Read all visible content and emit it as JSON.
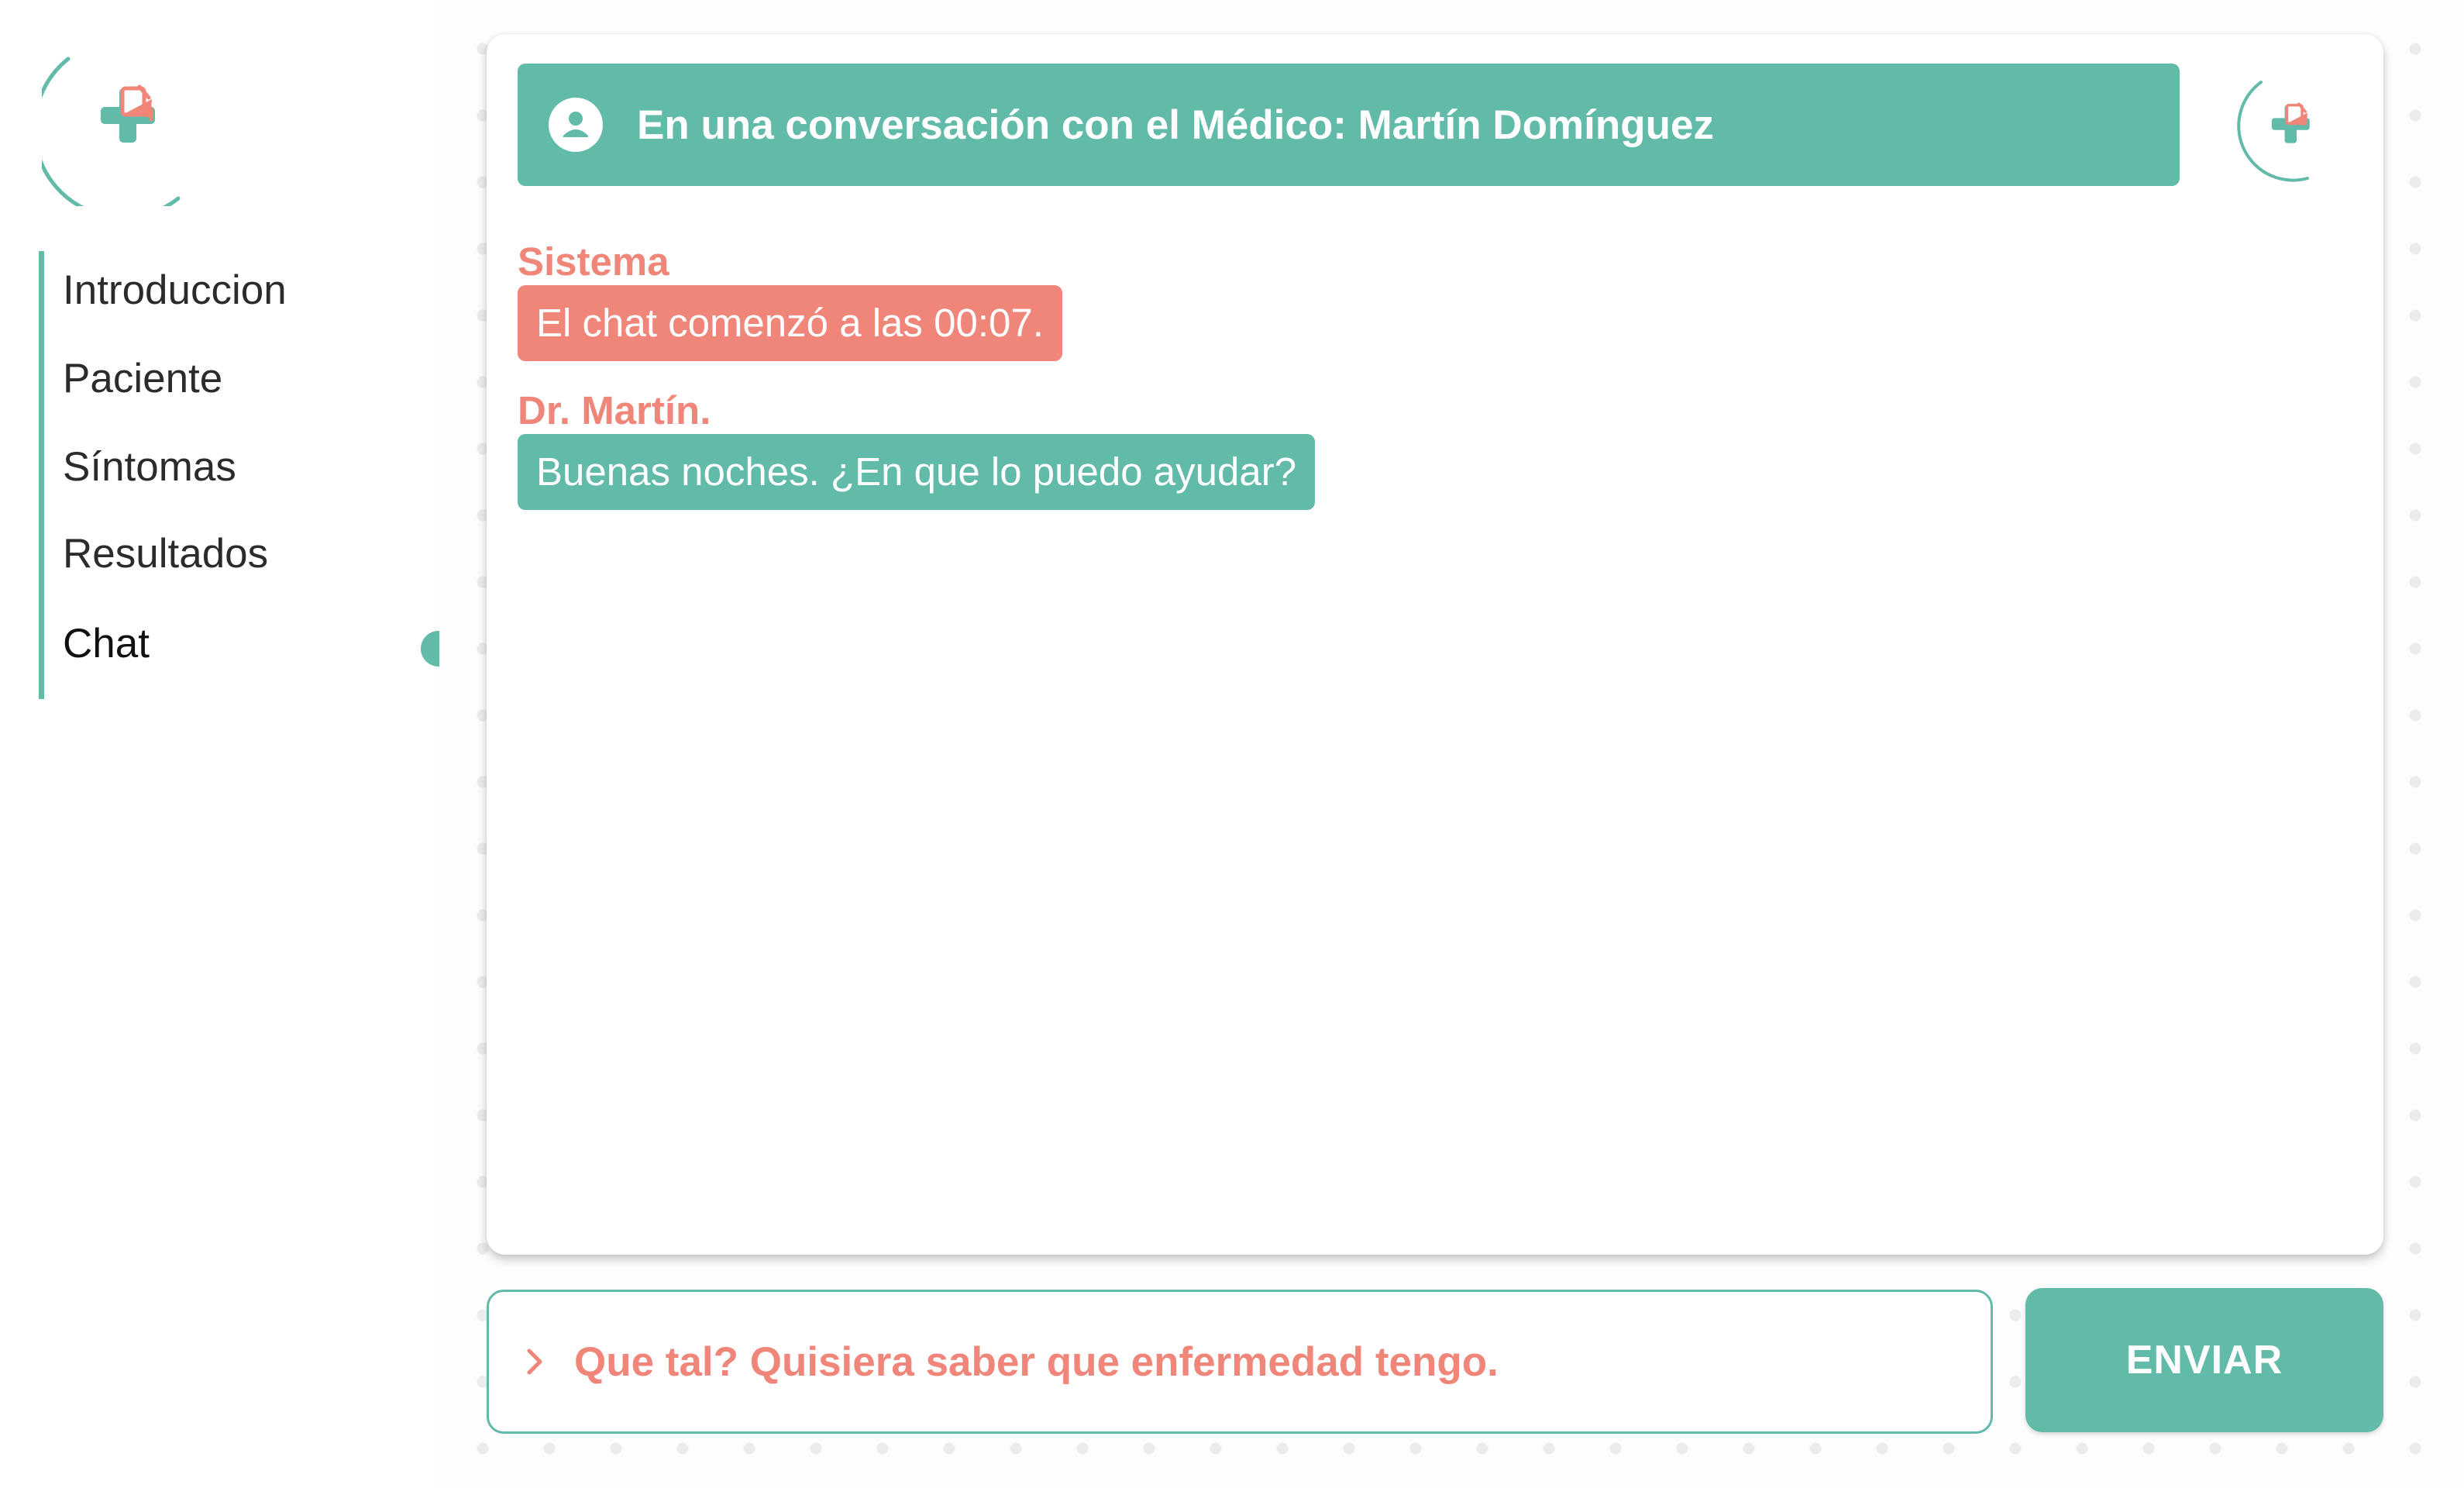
{
  "colors": {
    "accent": "#62baa9",
    "highlight": "#f0867a",
    "text": "#2b2b2b"
  },
  "brand": {
    "logo_icon": "medical-cross-logo-icon"
  },
  "sidebar": {
    "items": [
      {
        "label": "Introduccion",
        "active": false
      },
      {
        "label": "Paciente",
        "active": false
      },
      {
        "label": "Síntomas",
        "active": false
      },
      {
        "label": "Resultados",
        "active": false
      },
      {
        "label": "Chat",
        "active": true
      }
    ]
  },
  "chat": {
    "header_icon": "user-icon",
    "title": "En una conversación con el Médico: Martín Domínguez",
    "messages": [
      {
        "sender": "Sistema",
        "text": "El chat comenzó a las 00:07.",
        "type": "system"
      },
      {
        "sender": "Dr. Martín.",
        "text": "Buenas noches. ¿En que lo puedo ayudar?",
        "type": "doctor"
      }
    ]
  },
  "composer": {
    "prompt_icon": "chevron-right-icon",
    "value": "Que tal? Quisiera saber que enfermedad tengo.",
    "send_label": "ENVIAR"
  }
}
